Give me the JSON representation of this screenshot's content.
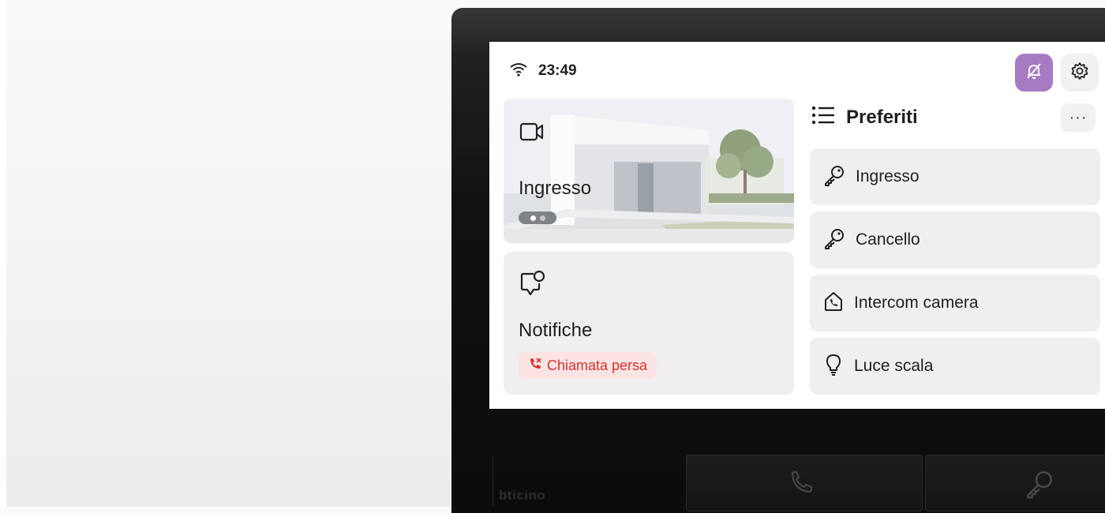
{
  "status_bar": {
    "time": "23:49"
  },
  "camera_card": {
    "label": "Ingresso"
  },
  "notifications_card": {
    "label": "Notifiche",
    "badge": "Chiamata persa"
  },
  "favorites": {
    "title": "Preferiti",
    "more_label": "···",
    "items": [
      {
        "label": "Ingresso",
        "icon": "key-icon"
      },
      {
        "label": "Cancello",
        "icon": "key-icon"
      },
      {
        "label": "Intercom camera",
        "icon": "intercom-icon"
      },
      {
        "label": "Luce scala",
        "icon": "lightbulb-icon"
      }
    ]
  },
  "device": {
    "brand": "bticino"
  },
  "colors": {
    "accent_purple": "#a77bc4",
    "card_bg": "#efeff2",
    "missed_red": "#d9312b",
    "missed_bg": "#fde4e4"
  }
}
